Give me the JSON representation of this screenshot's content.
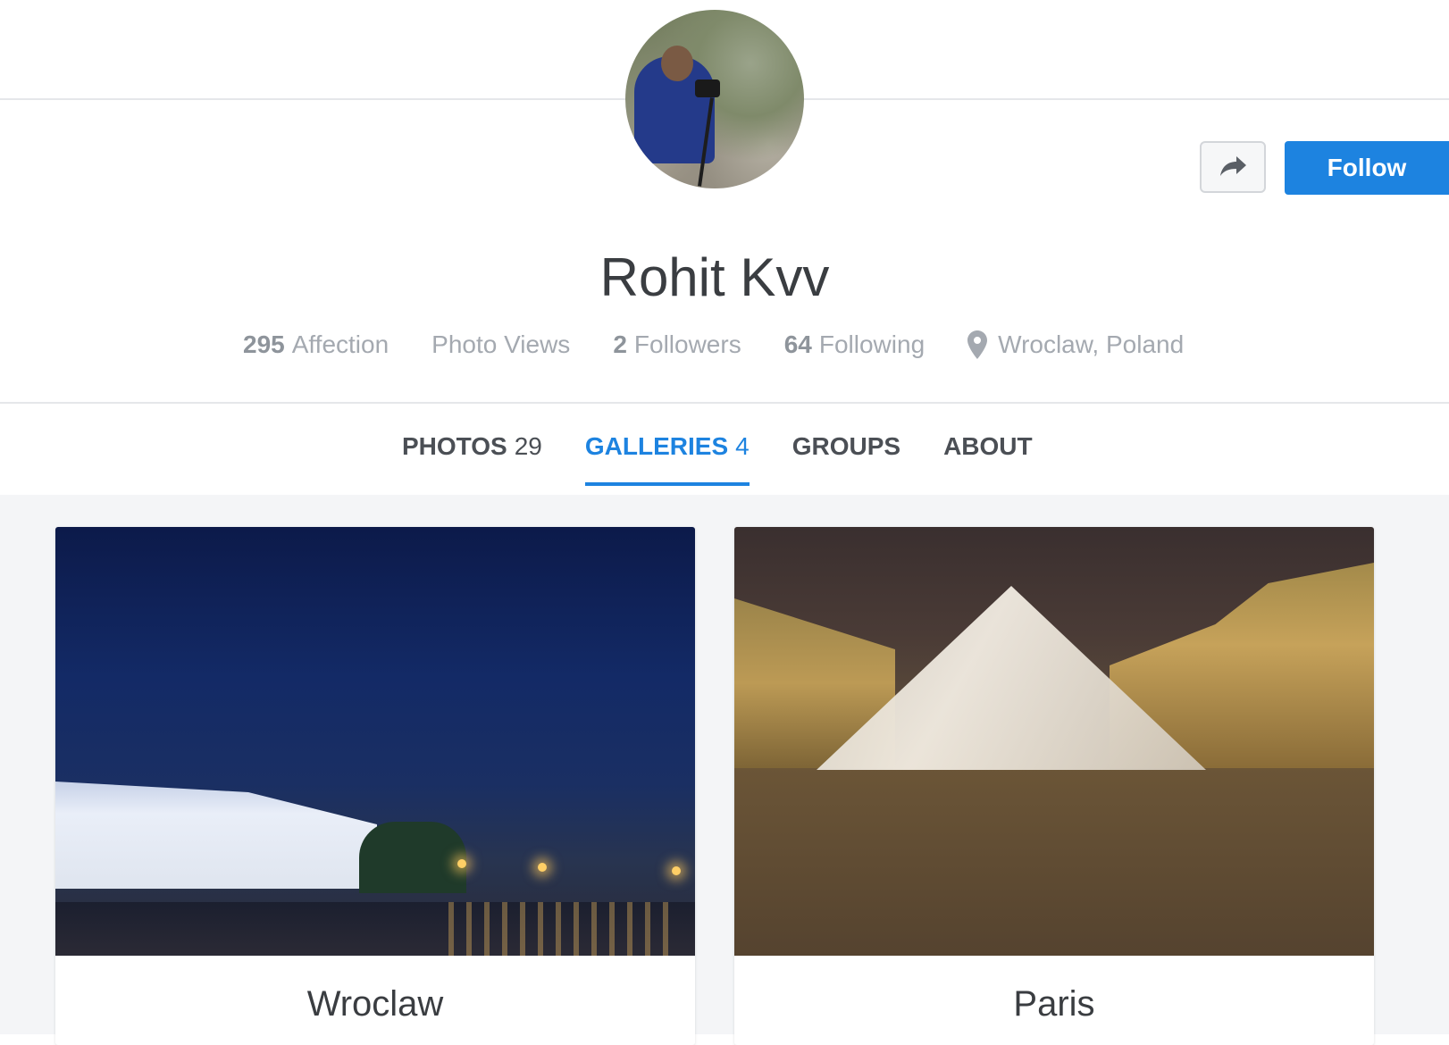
{
  "profile": {
    "name": "Rohit Kvv",
    "actions": {
      "share_icon": "share-arrow-icon",
      "follow_label": "Follow"
    },
    "stats": {
      "affection_count": "295",
      "affection_label": "Affection",
      "photo_views_label": "Photo Views",
      "followers_count": "2",
      "followers_label": "Followers",
      "following_count": "64",
      "following_label": "Following",
      "location": "Wroclaw, Poland"
    }
  },
  "tabs": [
    {
      "label": "PHOTOS",
      "count": "29",
      "active": false
    },
    {
      "label": "GALLERIES",
      "count": "4",
      "active": true
    },
    {
      "label": "GROUPS",
      "count": "",
      "active": false
    },
    {
      "label": "ABOUT",
      "count": "",
      "active": false
    }
  ],
  "galleries": [
    {
      "title": "Wroclaw"
    },
    {
      "title": "Paris"
    }
  ],
  "colors": {
    "accent": "#1d83e0",
    "text": "#3a3d41",
    "muted": "#a4a9b0",
    "background": "#f4f5f7"
  }
}
